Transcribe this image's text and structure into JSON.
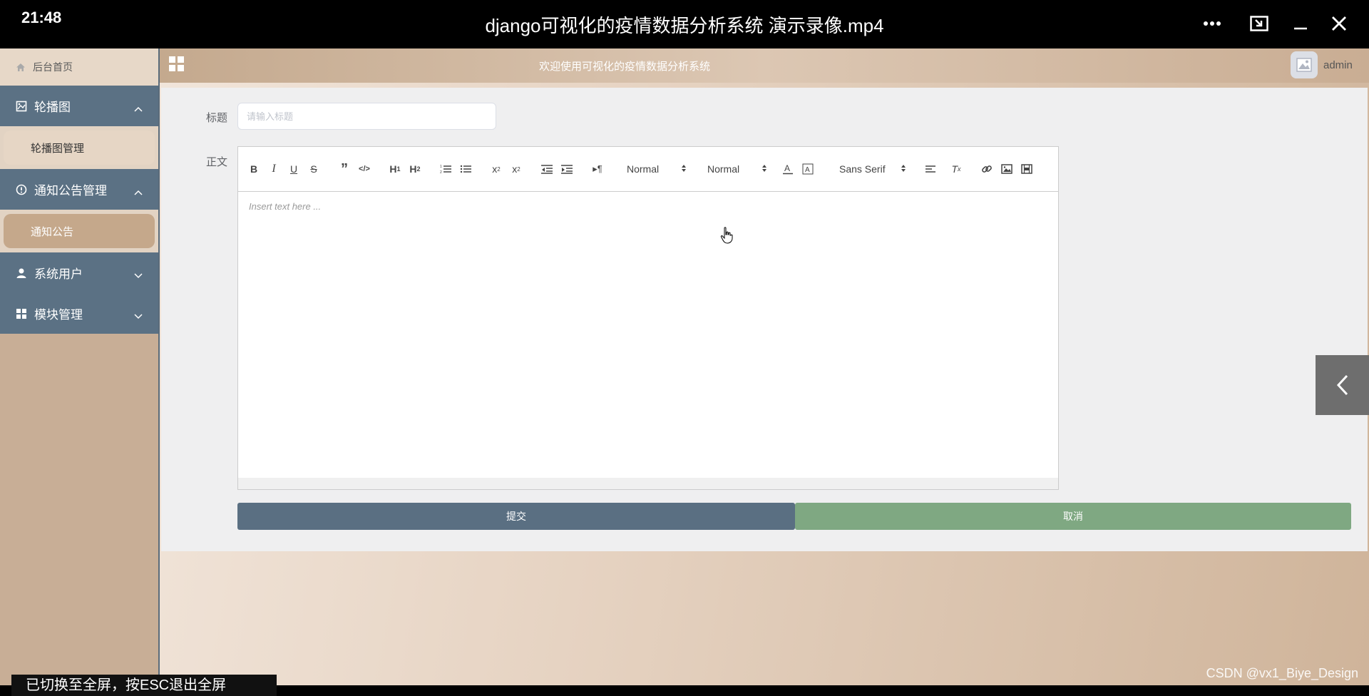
{
  "player": {
    "time": "21:48",
    "title": "django可视化的疫情数据分析系统 演示录像.mp4"
  },
  "sidebar": {
    "home": "后台首页",
    "groups": [
      {
        "label": "轮播图",
        "sub": "轮播图管理"
      },
      {
        "label": "通知公告管理",
        "sub": "通知公告"
      },
      {
        "label": "系统用户"
      },
      {
        "label": "模块管理"
      }
    ]
  },
  "topbar": {
    "welcome": "欢迎使用可视化的疫情数据分析系统",
    "username": "admin"
  },
  "form": {
    "title_label": "标题",
    "title_placeholder": "请输入标题",
    "body_label": "正文",
    "editor_placeholder": "Insert text here ...",
    "size_picker": "Normal",
    "header_picker": "Normal",
    "font_picker": "Sans Serif",
    "submit_label": "提交",
    "cancel_label": "取消"
  },
  "overlay": {
    "hint": "已切换至全屏，按ESC退出全屏",
    "watermark": "CSDN @vx1_Biye_Design"
  },
  "colors": {
    "sidebar_group": "#5b7184",
    "submit": "#5a6f82",
    "cancel": "#7fa882"
  }
}
